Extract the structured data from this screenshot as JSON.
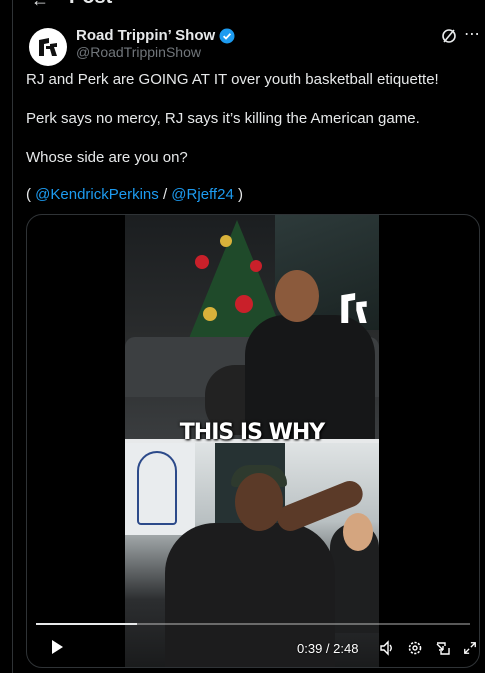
{
  "header": {
    "title": "Post",
    "back_icon": "arrow-left-icon"
  },
  "author": {
    "display_name": "Road Trippin’ Show",
    "handle": "@RoadTrippinShow",
    "verified": true,
    "avatar_icon": "road-trippin-logo-icon"
  },
  "post": {
    "line1": "RJ and Perk are GOING AT IT over youth basketball etiquette!",
    "line2": "Perk says no mercy, RJ says it’s killing the American game.",
    "line3": "Whose side are you on?",
    "line4_open": "( ",
    "mention1": "@KendrickPerkins",
    "line4_sep": " / ",
    "mention2": "@Rjeff24",
    "line4_close": " )"
  },
  "video": {
    "caption": "THIS IS WHY",
    "time": "0:39 / 2:48",
    "progress": 0.232
  },
  "icons": [
    "grok-icon",
    "more-icon",
    "play-icon",
    "volume-icon",
    "settings-icon",
    "picture-in-picture-icon",
    "fullscreen-icon"
  ],
  "colors": {
    "background": "#000000",
    "text": "#e7e9ea",
    "muted": "#71767b",
    "link": "#1d9bf0",
    "verified": "#1d9bf0"
  }
}
